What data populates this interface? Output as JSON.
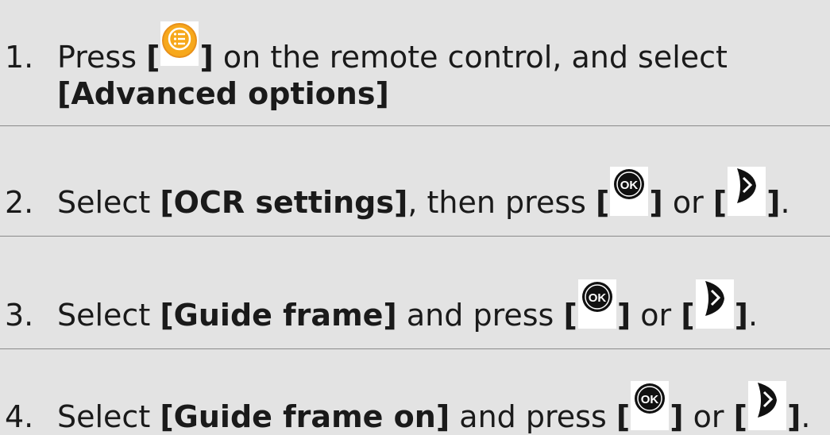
{
  "steps": [
    {
      "number": "1.",
      "text_a": "Press ",
      "bracket_open": "[",
      "icon": "menu-button-icon",
      "bracket_close": "]",
      "text_b": " on the remote control, and select",
      "line2_bold": "[Advanced options]"
    },
    {
      "number": "2.",
      "text_a": "Select ",
      "bold": "[OCR settings]",
      "text_b": ", then press ",
      "bracket_open": "[",
      "icon1": "ok-button-icon",
      "bracket_close": "]",
      "or": " or ",
      "bracket_open2": "[",
      "icon2": "right-arrow-button-icon",
      "bracket_close2": "]",
      "end": "."
    },
    {
      "number": "3.",
      "text_a": "Select ",
      "bold": "[Guide frame]",
      "text_b": " and press ",
      "bracket_open": "[",
      "icon1": "ok-button-icon",
      "bracket_close": "]",
      "or": " or ",
      "bracket_open2": "[",
      "icon2": "right-arrow-button-icon",
      "bracket_close2": "]",
      "end": "."
    },
    {
      "number": "4.",
      "text_a": "Select ",
      "bold": "[Guide frame on]",
      "text_b": " and press ",
      "bracket_open": "[",
      "icon1": "ok-button-icon",
      "bracket_close": "]",
      "or": " or ",
      "bracket_open2": "[",
      "icon2": "right-arrow-button-icon",
      "bracket_close2": "]",
      "end": "."
    }
  ],
  "icons": {
    "menu_color": "#f7a81b",
    "ok_label": "OK",
    "button_color": "#111111"
  }
}
